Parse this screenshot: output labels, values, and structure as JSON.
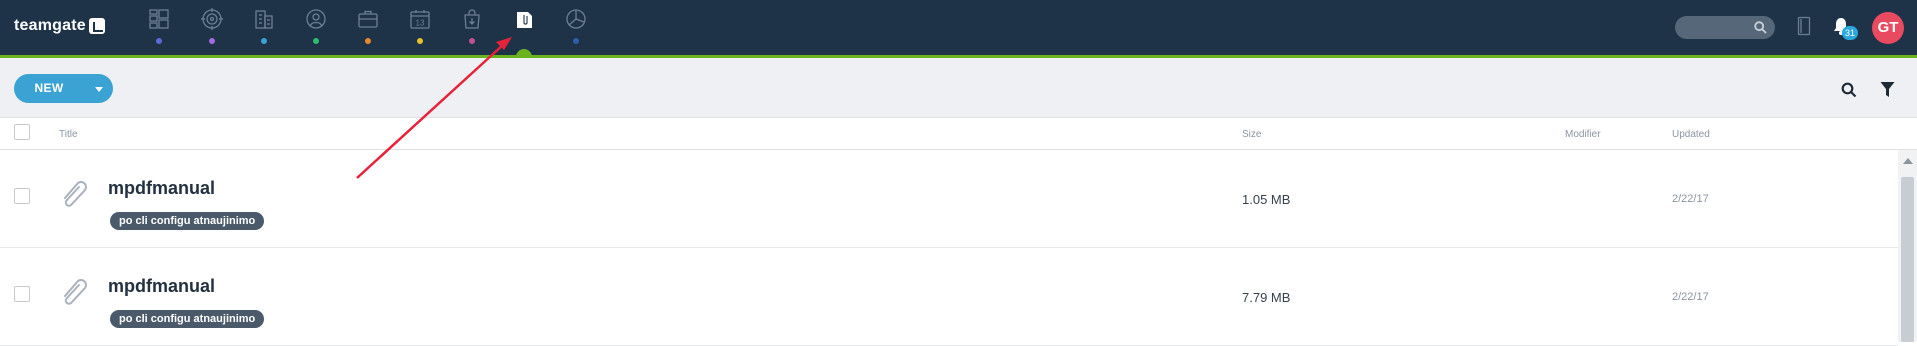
{
  "app": {
    "logo_text": "teamgate",
    "brand_color": "#1e3248",
    "accent_color": "#6ab31f"
  },
  "nav": {
    "items": [
      {
        "icon": "dashboard-icon",
        "dot_color": "#5b6bd9"
      },
      {
        "icon": "target-icon",
        "dot_color": "#a46be0"
      },
      {
        "icon": "building-icon",
        "dot_color": "#3aa3d4"
      },
      {
        "icon": "contact-icon",
        "dot_color": "#2ebd6b"
      },
      {
        "icon": "briefcase-icon",
        "dot_color": "#e68a2e"
      },
      {
        "icon": "calendar-icon",
        "calendar_number": "13",
        "dot_color": "#e6c12e"
      },
      {
        "icon": "bag-icon",
        "dot_color": "#c0508f"
      },
      {
        "icon": "files-icon",
        "active": true
      },
      {
        "icon": "pie-chart-icon",
        "dot_color": "#2e5fa8"
      }
    ]
  },
  "header_right": {
    "search_icon": "search-icon",
    "phone_icon": "phone-icon",
    "notifications_count": "31",
    "avatar_initials": "GT",
    "avatar_color": "#e84a5f"
  },
  "toolbar": {
    "new_label": "NEW",
    "search_icon": "search-icon",
    "filter_icon": "filter-icon"
  },
  "table": {
    "columns": {
      "title": "Title",
      "size": "Size",
      "modifier": "Modifier",
      "updated": "Updated"
    },
    "rows": [
      {
        "title": "mpdfmanual",
        "tag": "po cli configu atnaujinimo",
        "size": "1.05 MB",
        "modifier": "",
        "updated": "2/22/17"
      },
      {
        "title": "mpdfmanual",
        "tag": "po cli configu atnaujinimo",
        "size": "7.79 MB",
        "modifier": "",
        "updated": "2/22/17"
      }
    ]
  },
  "annotation": {
    "arrow_color": "#e8223a"
  }
}
